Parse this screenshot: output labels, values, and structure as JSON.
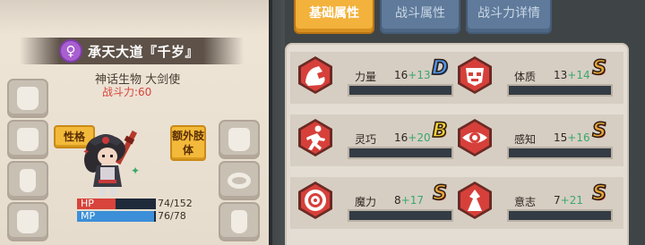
{
  "character": {
    "gender_symbol": "♀",
    "name": "承天大道『千岁』",
    "class": "神话生物 大剑使",
    "power": "战斗力:60",
    "trait_button": "性格",
    "extra_limb_button": "额外肢体",
    "hp": {
      "label": "HP",
      "current": 74,
      "max": 152,
      "text": "74/152",
      "color": "#d8433b"
    },
    "mp": {
      "label": "MP",
      "current": 76,
      "max": 78,
      "text": "76/78",
      "color": "#3b8fd8"
    }
  },
  "equipment_slots": {
    "left": [
      "helmet-slot",
      "gloves-slot",
      "boots-slot",
      "armor-slot"
    ],
    "right": [
      "cloak-slot",
      "ring-slot",
      "relic-slot",
      "greaves-slot"
    ]
  },
  "tabs": [
    {
      "label": "基础属性",
      "active": true
    },
    {
      "label": "战斗属性",
      "active": false
    },
    {
      "label": "战斗力详情",
      "active": false
    }
  ],
  "stats": [
    {
      "name": "力量",
      "value": "16",
      "bonus": "+13",
      "grade": "D",
      "icon": "strength-icon"
    },
    {
      "name": "体质",
      "value": "13",
      "bonus": "+14",
      "grade": "S",
      "icon": "constitution-icon"
    },
    {
      "name": "灵巧",
      "value": "16",
      "bonus": "+20",
      "grade": "B",
      "icon": "agility-icon"
    },
    {
      "name": "感知",
      "value": "15",
      "bonus": "+16",
      "grade": "S",
      "icon": "perception-icon"
    },
    {
      "name": "魔力",
      "value": "8",
      "bonus": "+17",
      "grade": "S",
      "icon": "magic-icon"
    },
    {
      "name": "意志",
      "value": "7",
      "bonus": "+21",
      "grade": "S",
      "icon": "willpower-icon"
    }
  ],
  "colors": {
    "icon_red": "#d7403a",
    "tab_active": "#f2b23c",
    "tab_inactive": "#5f7a9a"
  }
}
